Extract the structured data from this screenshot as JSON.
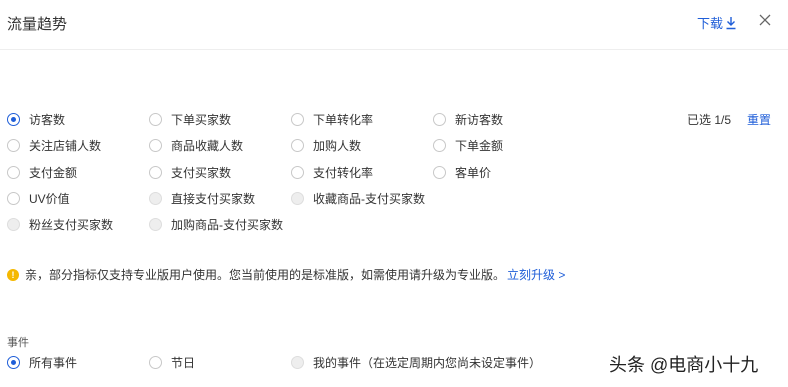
{
  "header": {
    "title": "流量趋势",
    "download_label": "下载",
    "download_icon": "download-icon",
    "close_icon": "close-icon"
  },
  "metrics": {
    "items": [
      {
        "label": "访客数",
        "state": "checked"
      },
      {
        "label": "下单买家数",
        "state": "unchecked"
      },
      {
        "label": "下单转化率",
        "state": "unchecked"
      },
      {
        "label": "新访客数",
        "state": "unchecked"
      },
      {
        "label": "关注店铺人数",
        "state": "unchecked"
      },
      {
        "label": "商品收藏人数",
        "state": "unchecked"
      },
      {
        "label": "加购人数",
        "state": "unchecked"
      },
      {
        "label": "下单金额",
        "state": "unchecked"
      },
      {
        "label": "支付金额",
        "state": "unchecked"
      },
      {
        "label": "支付买家数",
        "state": "unchecked"
      },
      {
        "label": "支付转化率",
        "state": "unchecked"
      },
      {
        "label": "客单价",
        "state": "unchecked"
      },
      {
        "label": "UV价值",
        "state": "unchecked"
      },
      {
        "label": "直接支付买家数",
        "state": "disabled"
      },
      {
        "label": "收藏商品-支付买家数",
        "state": "disabled"
      },
      {
        "label": "粉丝支付买家数",
        "state": "disabled"
      },
      {
        "label": "加购商品-支付买家数",
        "state": "disabled"
      }
    ],
    "selected_count": "已选 1/5",
    "reset_label": "重置"
  },
  "notice": {
    "text": "亲，部分指标仅支持专业版用户使用。您当前使用的是标准版，如需使用请升级为专业版。",
    "upgrade_label": "立刻升级 >",
    "icon": "warning-icon",
    "icon_color": "#f5b800"
  },
  "events": {
    "title": "事件",
    "options": [
      {
        "label": "所有事件",
        "state": "checked"
      },
      {
        "label": "节日",
        "state": "unchecked"
      },
      {
        "label": "我的事件（在选定周期内您尚未设定事件）",
        "state": "disabled"
      }
    ]
  },
  "watermark": "头条 @电商小十九",
  "colors": {
    "accent": "#1f5ed8",
    "warning": "#f5b800"
  }
}
